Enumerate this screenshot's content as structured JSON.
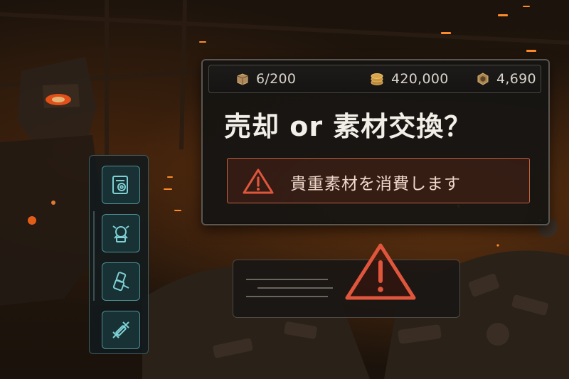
{
  "resources": {
    "inventory": "6/200",
    "coins": "420,000",
    "material": "4,690"
  },
  "dialog": {
    "title": "売却 or 素材交換？",
    "warning_text": "貴重素材を消費します"
  },
  "sidebar": {
    "items": [
      {
        "icon": "document-gear-icon"
      },
      {
        "icon": "mech-part-icon"
      },
      {
        "icon": "armor-part-icon"
      },
      {
        "icon": "weapon-part-icon"
      }
    ]
  },
  "colors": {
    "warning": "#d8533a",
    "accent_teal": "#4f8f93",
    "panel_border": "#5b5650",
    "text": "#f2efe9",
    "resource_icon": "#c9a36a"
  }
}
